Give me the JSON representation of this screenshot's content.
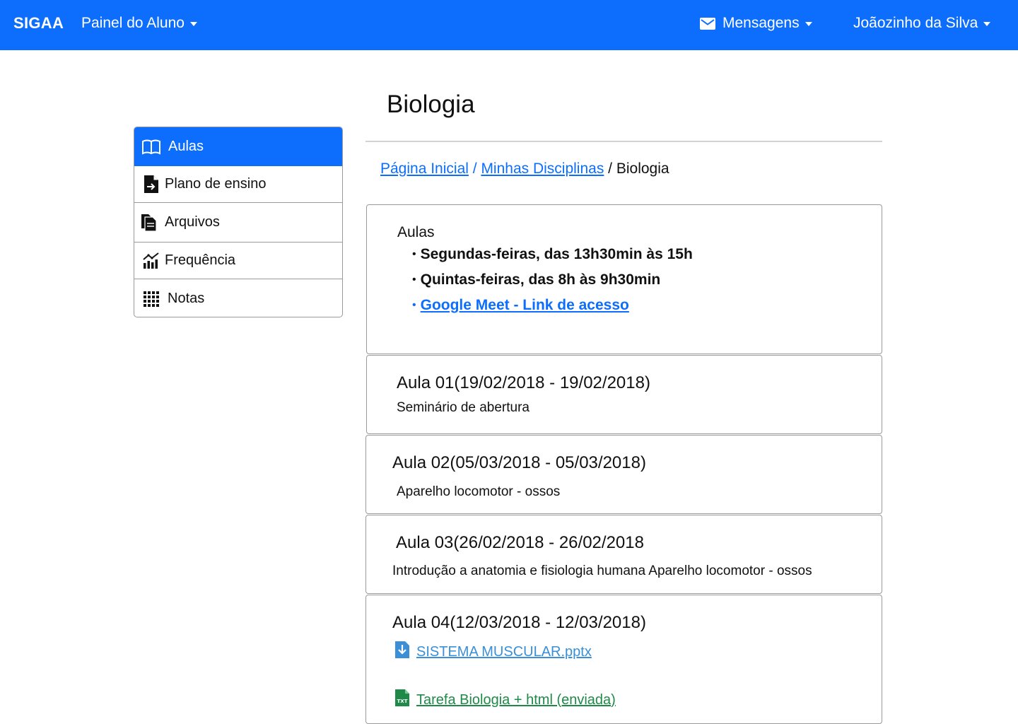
{
  "header": {
    "brand": "SIGAA",
    "menu_label": "Painel do Aluno",
    "messages_label": "Mensagens",
    "user_name": "Joãozinho da Silva"
  },
  "page": {
    "title": "Biologia"
  },
  "breadcrumb": {
    "home": "Página Inicial",
    "sep1": " / ",
    "disciplines": "Minhas Disciplinas",
    "sep2": " / ",
    "current": "Biologia"
  },
  "sidebar": {
    "items": [
      {
        "label": "Aulas",
        "icon": "book-open-icon",
        "active": true
      },
      {
        "label": "Plano de ensino",
        "icon": "file-arrow-icon",
        "active": false
      },
      {
        "label": "Arquivos",
        "icon": "files-icon",
        "active": false
      },
      {
        "label": "Frequência",
        "icon": "chart-bar-icon",
        "active": false
      },
      {
        "label": "Notas",
        "icon": "grid-icon",
        "active": false
      }
    ]
  },
  "schedule": {
    "title": "Aulas",
    "items": [
      "Segundas-feiras, das 13h30min às 15h",
      "Quintas-feiras, das 8h  às 9h30min"
    ],
    "bullet": "•",
    "meet_link": "Google Meet - Link de acesso"
  },
  "lessons": [
    {
      "title": "Aula 01(19/02/2018 - 19/02/2018)",
      "description": "Seminário de abertura"
    },
    {
      "title": "Aula 02(05/03/2018 - 05/03/2018)",
      "description": "Aparelho locomotor - ossos"
    },
    {
      "title": "Aula 03(26/02/2018 - 26/02/2018",
      "description": "Introdução a anatomia e fisiologia humana Aparelho locomotor -  ossos"
    },
    {
      "title": "Aula 04(12/03/2018 - 12/03/2018)",
      "files": [
        {
          "name": "SISTEMA MUSCULAR.pptx",
          "icon": "download-file-icon"
        },
        {
          "name": "Tarefa Biologia + html (enviada)",
          "icon": "txt-file-icon"
        }
      ]
    }
  ],
  "colors": {
    "primary": "#0d6efd",
    "border": "#9a9a9a",
    "file_blue": "#3a8fd6",
    "file_green": "#1f8a48"
  }
}
